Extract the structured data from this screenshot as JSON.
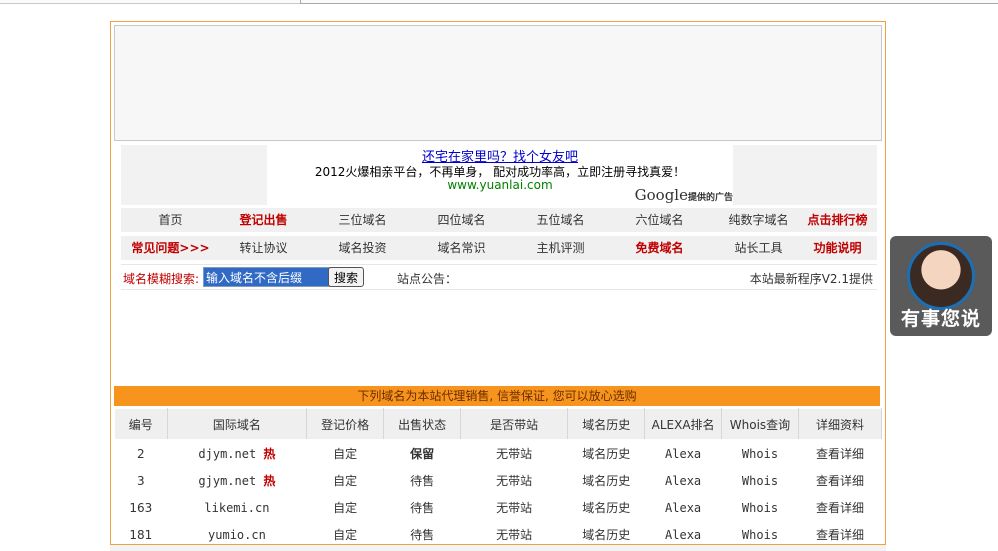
{
  "ad": {
    "title": "还宅在家里吗？找个女友吧",
    "desc": "2012火爆相亲平台，不再单身， 配对成功率高，立即注册寻找真爱！",
    "url": "www.yuanlai.com",
    "google_logo": "Google",
    "google_suffix": "提供的广告"
  },
  "nav": {
    "row1": [
      {
        "label": "首页",
        "red": false
      },
      {
        "label": "登记出售",
        "red": true
      },
      {
        "label": "三位域名",
        "red": false
      },
      {
        "label": "四位域名",
        "red": false
      },
      {
        "label": "五位域名",
        "red": false
      },
      {
        "label": "六位域名",
        "red": false
      },
      {
        "label": "纯数字域名",
        "red": false
      },
      {
        "label": "点击排行榜",
        "red": true
      }
    ],
    "row2": [
      {
        "label": "常见问题>>>",
        "red": true
      },
      {
        "label": "转让协议",
        "red": false
      },
      {
        "label": "域名投资",
        "red": false
      },
      {
        "label": "域名常识",
        "red": false
      },
      {
        "label": "主机评测",
        "red": false
      },
      {
        "label": "免费域名",
        "red": true
      },
      {
        "label": "站长工具",
        "red": false
      },
      {
        "label": "功能说明",
        "red": true
      }
    ]
  },
  "search": {
    "label": "域名模糊搜索:",
    "value": "输入域名不含后缀",
    "button": "搜索",
    "notice": "站点公告：",
    "provided": "本站最新程序V2.1提供"
  },
  "banner": "下列域名为本站代理销售, 信誉保证, 您可以放心选购",
  "table": {
    "headers": [
      "编号",
      "国际域名",
      "登记价格",
      "出售状态",
      "是否带站",
      "域名历史",
      "ALEXA排名",
      "Whois查询",
      "详细资料"
    ],
    "rows": [
      {
        "id": "2",
        "domain": "djym.net",
        "hot": "热",
        "price": "自定",
        "status": "保留",
        "site": "无带站",
        "history": "域名历史",
        "alexa": "Alexa",
        "whois": "Whois",
        "detail": "查看详细"
      },
      {
        "id": "3",
        "domain": "gjym.net",
        "hot": "热",
        "price": "自定",
        "status": "待售",
        "site": "无带站",
        "history": "域名历史",
        "alexa": "Alexa",
        "whois": "Whois",
        "detail": "查看详细"
      },
      {
        "id": "163",
        "domain": "likemi.cn",
        "hot": "",
        "price": "自定",
        "status": "待售",
        "site": "无带站",
        "history": "域名历史",
        "alexa": "Alexa",
        "whois": "Whois",
        "detail": "查看详细"
      },
      {
        "id": "181",
        "domain": "yumio.cn",
        "hot": "",
        "price": "自定",
        "status": "待售",
        "site": "无带站",
        "history": "域名历史",
        "alexa": "Alexa",
        "whois": "Whois",
        "detail": "查看详细"
      }
    ]
  },
  "chat": {
    "label": "有事您说"
  },
  "colors": {
    "accent": "#f7941d",
    "border": "#f0a040",
    "red": "#c00000",
    "blue": "#0066aa"
  }
}
